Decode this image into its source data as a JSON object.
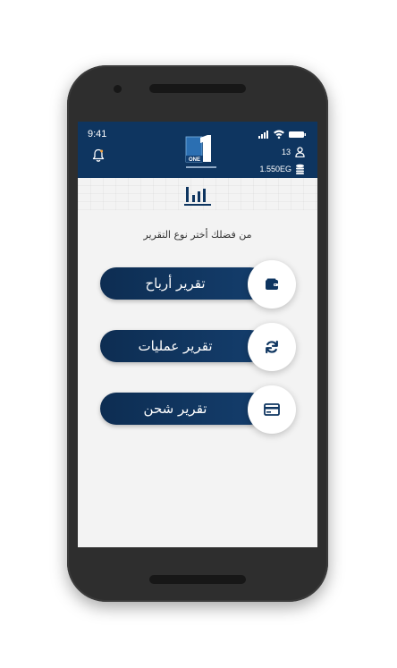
{
  "status_bar": {
    "time": "9:41"
  },
  "header": {
    "notification_count": "13",
    "balance": "1.550EG"
  },
  "main": {
    "prompt": "من فضلك أختر نوع التقرير",
    "reports": [
      {
        "label": "تقرير أرباح",
        "icon": "wallet-icon"
      },
      {
        "label": "تقرير عمليات",
        "icon": "refresh-icon"
      },
      {
        "label": "تقرير شحن",
        "icon": "credit-card-icon"
      }
    ]
  },
  "colors": {
    "header": "#0e3560",
    "button": "#0d2d52",
    "circle": "#ffffff",
    "phone": "#2e2e2e"
  }
}
